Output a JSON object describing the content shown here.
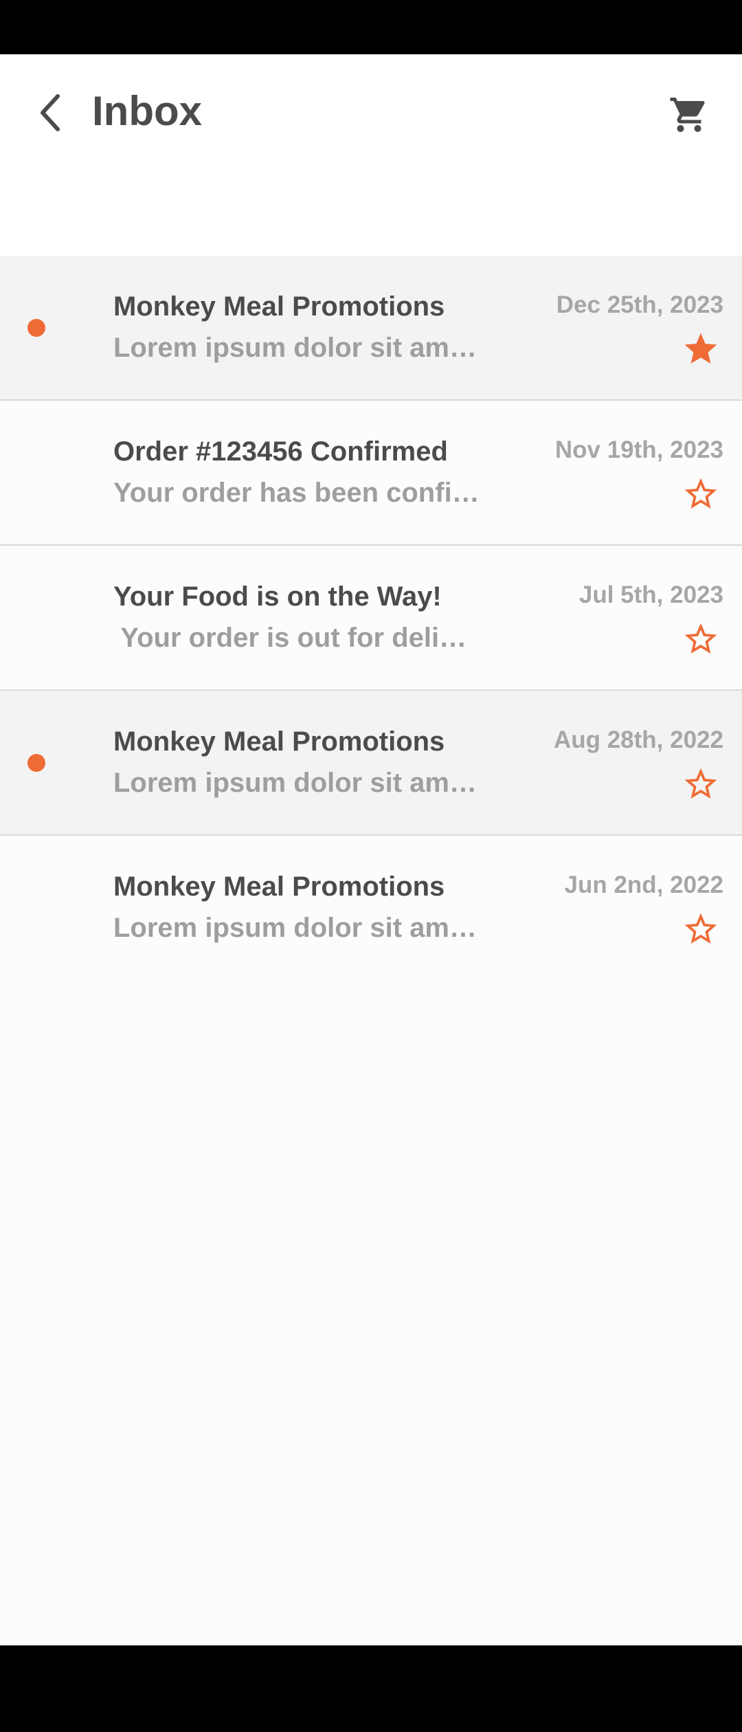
{
  "header": {
    "title": "Inbox",
    "back_icon": "chevron-left-icon",
    "cart_icon": "shopping-cart-icon"
  },
  "colors": {
    "accent": "#ef6b35",
    "title_text": "#4a4b4d",
    "secondary_text": "#9e9e9e",
    "unread_background": "#f3f3f3"
  },
  "messages": [
    {
      "subject": "Monkey Meal Promotions",
      "preview": "Lorem ipsum dolor sit amet, consectetur",
      "date": "Dec 25th, 2023",
      "unread": true,
      "starred": true
    },
    {
      "subject": "Order #123456 Confirmed",
      "preview": "Your order has been confirmed",
      "date": "Nov 19th, 2023",
      "unread": false,
      "starred": false
    },
    {
      "subject": "Your Food is on the Way!",
      "preview": " Your order is out for delivery",
      "date": "Jul 5th, 2023",
      "unread": false,
      "starred": false
    },
    {
      "subject": "Monkey Meal Promotions",
      "preview": "Lorem ipsum dolor sit amet, consectetur",
      "date": "Aug 28th, 2022",
      "unread": true,
      "starred": false
    },
    {
      "subject": "Monkey Meal Promotions",
      "preview": "Lorem ipsum dolor sit amet, consectetur",
      "date": "Jun 2nd, 2022",
      "unread": false,
      "starred": false
    }
  ]
}
